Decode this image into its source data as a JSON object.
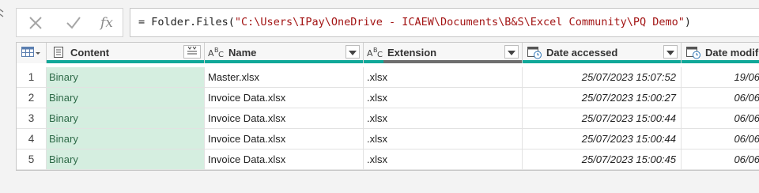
{
  "formula_bar": {
    "cancel_icon": "x-icon",
    "confirm_icon": "checkmark-icon",
    "fx_label": "fx",
    "formula_prefix": "= Folder.Files(",
    "formula_string": "\"C:\\Users\\IPay\\OneDrive - ICAEW\\Documents\\B&S\\Excel Community\\PQ Demo\"",
    "formula_suffix": ")"
  },
  "grid": {
    "columns": [
      {
        "label": "Content",
        "type_icon": "table-icon"
      },
      {
        "label": "Name",
        "type_icon": "abc-icon"
      },
      {
        "label": "Extension",
        "type_icon": "abc-icon"
      },
      {
        "label": "Date accessed",
        "type_icon": "calendar-clock-icon"
      },
      {
        "label": "Date modif",
        "type_icon": "calendar-clock-icon"
      }
    ],
    "rows": [
      {
        "num": "1",
        "content": "Binary",
        "name": "Master.xlsx",
        "extension": ".xlsx",
        "accessed": "25/07/2023 15:07:52",
        "modified": "19/06"
      },
      {
        "num": "2",
        "content": "Binary",
        "name": "Invoice Data.xlsx",
        "extension": ".xlsx",
        "accessed": "25/07/2023 15:00:27",
        "modified": "06/06"
      },
      {
        "num": "3",
        "content": "Binary",
        "name": "Invoice Data.xlsx",
        "extension": ".xlsx",
        "accessed": "25/07/2023 15:00:44",
        "modified": "06/06"
      },
      {
        "num": "4",
        "content": "Binary",
        "name": "Invoice Data.xlsx",
        "extension": ".xlsx",
        "accessed": "25/07/2023 15:00:44",
        "modified": "06/06"
      },
      {
        "num": "5",
        "content": "Binary",
        "name": "Invoice Data.xlsx",
        "extension": ".xlsx",
        "accessed": "25/07/2023 15:00:45",
        "modified": "06/06"
      }
    ]
  },
  "colors": {
    "quality_bar": "#10a899",
    "quality_bar_gray": "#6e6e6e",
    "content_cell_bg": "#d5eee0",
    "formula_string": "#a31515"
  }
}
